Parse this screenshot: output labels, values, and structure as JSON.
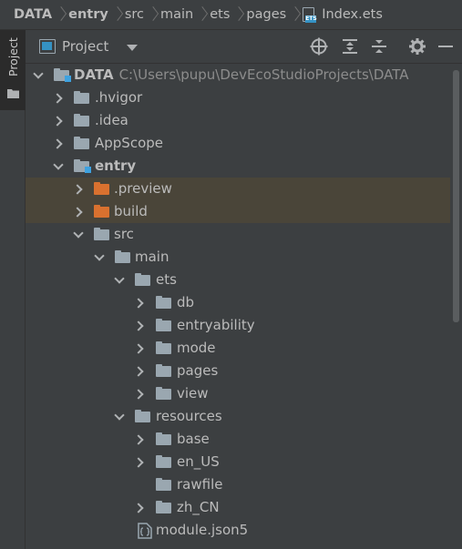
{
  "breadcrumb": {
    "items": [
      "DATA",
      "entry",
      "src",
      "main",
      "ets",
      "pages",
      "Index.ets"
    ],
    "file_icon_tag": "ETS"
  },
  "tool_strip": {
    "label": "Project"
  },
  "panel": {
    "title": "Project",
    "buttons": [
      "locate-icon",
      "expand-all-icon",
      "collapse-all-icon",
      "settings-gear-icon",
      "minimize-icon"
    ]
  },
  "tree": {
    "root": {
      "name": "DATA",
      "path": "C:\\Users\\pupu\\DevEcoStudioProjects\\DATA"
    },
    "items": [
      {
        "label": ".hvigor"
      },
      {
        "label": ".idea"
      },
      {
        "label": "AppScope"
      },
      {
        "label": "entry"
      },
      {
        "label": ".preview"
      },
      {
        "label": "build"
      },
      {
        "label": "src"
      },
      {
        "label": "main"
      },
      {
        "label": "ets"
      },
      {
        "label": "db"
      },
      {
        "label": "entryability"
      },
      {
        "label": "mode"
      },
      {
        "label": "pages"
      },
      {
        "label": "view"
      },
      {
        "label": "resources"
      },
      {
        "label": "base"
      },
      {
        "label": "en_US"
      },
      {
        "label": "rawfile"
      },
      {
        "label": "zh_CN"
      },
      {
        "label": "module.json5"
      }
    ]
  },
  "colors": {
    "background": "#3c3f41",
    "excluded_row": "#4a4539",
    "folder": "#9aa7b0",
    "excluded_folder": "#d9712f",
    "module_marker": "#3ea2e0"
  }
}
